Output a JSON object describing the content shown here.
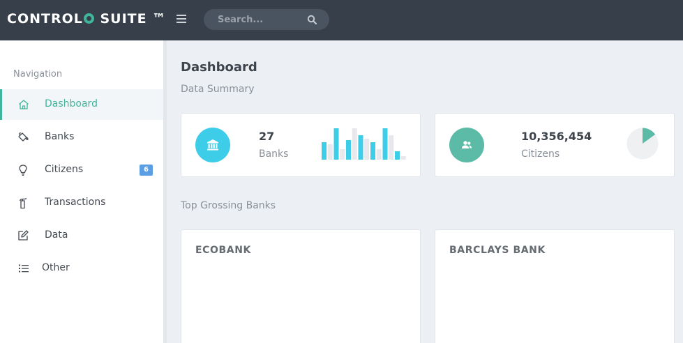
{
  "header": {
    "brand_left": "CONTROL",
    "brand_right": "SUITE ™",
    "search_placeholder": "Search..."
  },
  "sidebar": {
    "heading": "Navigation",
    "items": [
      {
        "label": "Dashboard",
        "icon": "home-icon",
        "active": true
      },
      {
        "label": "Banks",
        "icon": "paint-bucket-icon"
      },
      {
        "label": "Citizens",
        "icon": "lightbulb-icon",
        "badge": "6"
      },
      {
        "label": "Transactions",
        "icon": "fire-extinguisher-icon"
      },
      {
        "label": "Data",
        "icon": "edit-icon"
      },
      {
        "label": "Other",
        "icon": "list-icon"
      }
    ]
  },
  "main": {
    "title": "Dashboard",
    "summary_label": "Data Summary",
    "stats": [
      {
        "value": "27",
        "label": "Banks",
        "icon": "bank-icon",
        "color": "#3dcde8"
      },
      {
        "value": "10,356,454",
        "label": "Citizens",
        "icon": "users-icon",
        "color": "#5cbba6"
      }
    ],
    "top_banks_label": "Top Grossing Banks",
    "banks": [
      {
        "name": "ECOBANK"
      },
      {
        "name": "BARCLAYS BANK"
      }
    ]
  },
  "colors": {
    "accent": "#3fb59c",
    "topbar": "#363f4a",
    "bar_primary": "#3dcde8",
    "bar_secondary": "#e6e8eb",
    "pie_slice": "#5cbba6",
    "pie_rest": "#eef0f2",
    "badge": "#5c9ee4"
  },
  "chart_data": [
    {
      "type": "bar",
      "series": [
        {
          "values": [
            25,
            45,
            28,
            35,
            25,
            45,
            12
          ]
        },
        {
          "values": [
            22,
            15,
            45,
            30,
            15,
            35,
            5
          ]
        }
      ]
    },
    {
      "type": "pie",
      "values": [
        15,
        85
      ]
    }
  ]
}
